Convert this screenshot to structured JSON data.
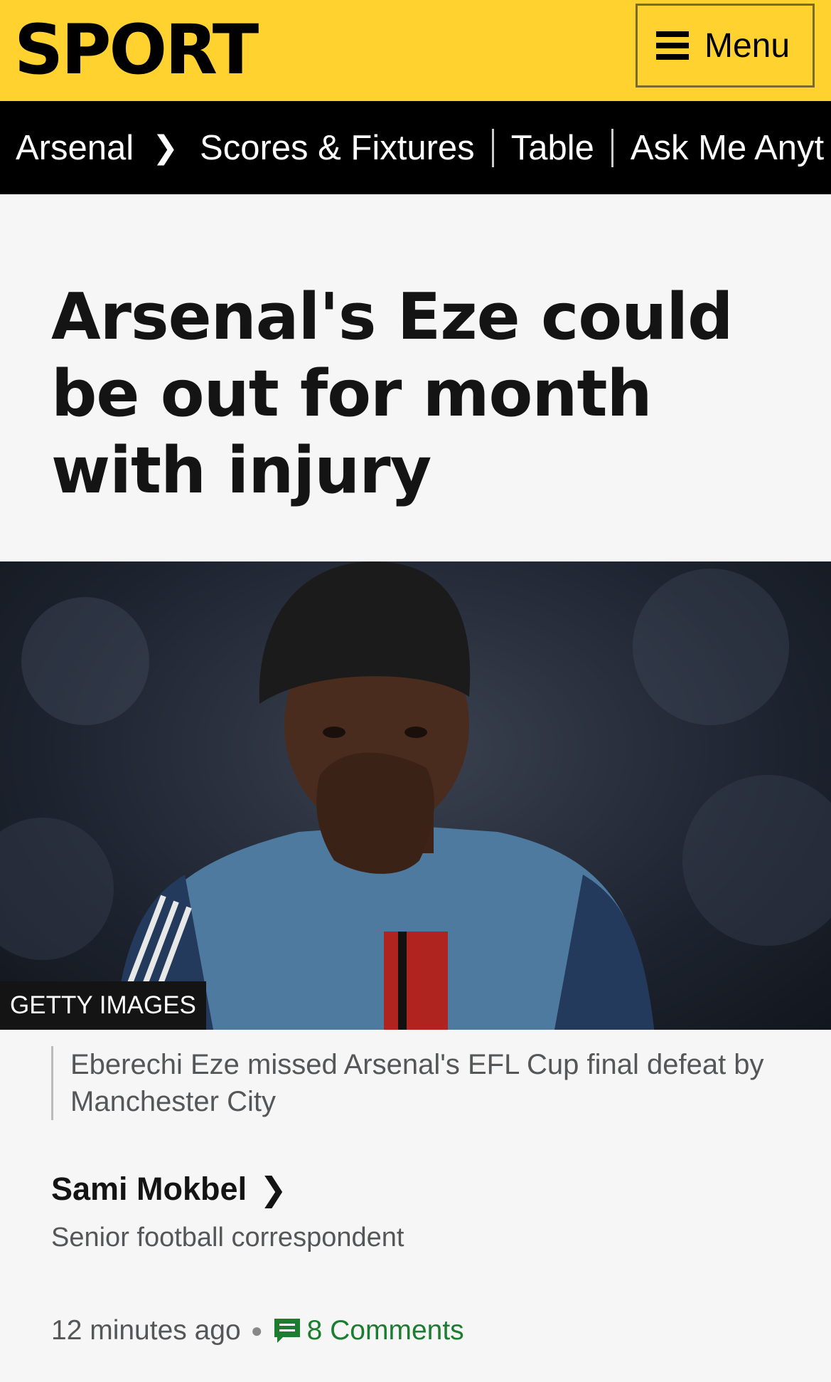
{
  "header": {
    "logo": "SPORT",
    "menu_label": "Menu",
    "menu_icon": "hamburger-icon",
    "bg_color": "#ffd230"
  },
  "subnav": {
    "items": [
      "Arsenal",
      "Scores & Fixtures",
      "Table",
      "Ask Me Anyt"
    ],
    "chevron_icon": "chevron-right-icon"
  },
  "article": {
    "headline": "Arsenal's Eze could be out for month with injury",
    "image_credit": "GETTY IMAGES",
    "caption": "Eberechi Eze missed Arsenal's EFL Cup final defeat by Manchester City",
    "author": "Sami Mokbel",
    "author_role": "Senior football correspondent",
    "time": "12 minutes ago",
    "comments_label": "8 Comments",
    "comments_icon": "comment-icon",
    "accent_color": "#1a7d2f"
  }
}
